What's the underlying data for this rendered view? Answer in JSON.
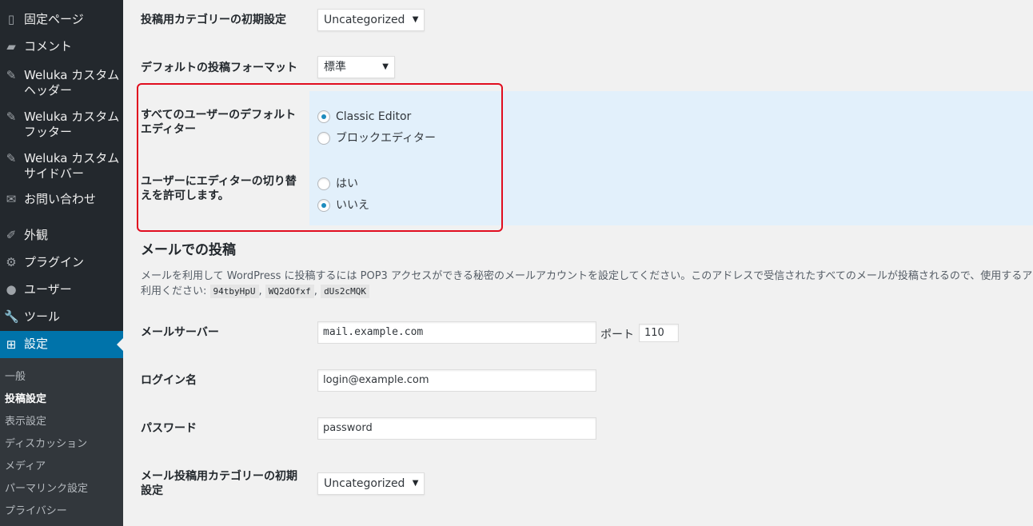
{
  "sidebar": {
    "items": [
      {
        "icon": "page-icon",
        "glyph": "▯",
        "label": "固定ページ"
      },
      {
        "icon": "comment-icon",
        "glyph": "▰",
        "label": "コメント"
      },
      {
        "icon": "pin-icon",
        "glyph": "✎",
        "label": "Weluka カスタムヘッダー"
      },
      {
        "icon": "pin-icon",
        "glyph": "✎",
        "label": "Weluka カスタムフッター"
      },
      {
        "icon": "pin-icon",
        "glyph": "✎",
        "label": "Weluka カスタムサイドバー"
      },
      {
        "icon": "mail-icon",
        "glyph": "✉",
        "label": "お問い合わせ"
      },
      {
        "icon": "appearance-icon",
        "glyph": "✐",
        "label": "外観"
      },
      {
        "icon": "plugin-icon",
        "glyph": "⚙",
        "label": "プラグイン"
      },
      {
        "icon": "user-icon",
        "glyph": "●",
        "label": "ユーザー"
      },
      {
        "icon": "tools-icon",
        "glyph": "🔧",
        "label": "ツール"
      },
      {
        "icon": "settings-icon",
        "glyph": "⊞",
        "label": "設定"
      }
    ],
    "submenu": [
      "一般",
      "投稿設定",
      "表示設定",
      "ディスカッション",
      "メディア",
      "パーマリンク設定",
      "プライバシー"
    ]
  },
  "settings": {
    "default_category_label": "投稿用カテゴリーの初期設定",
    "default_category_value": "Uncategorized",
    "default_format_label": "デフォルトの投稿フォーマット",
    "default_format_value": "標準",
    "editor_label": "すべてのユーザーのデフォルトエディター",
    "editor_options": [
      "Classic Editor",
      "ブロックエディター"
    ],
    "editor_selected": "Classic Editor",
    "allow_switch_label": "ユーザーにエディターの切り替えを許可します。",
    "allow_switch_options": [
      "はい",
      "いいえ"
    ],
    "allow_switch_selected": "いいえ"
  },
  "mail": {
    "section_title": "メールでの投稿",
    "description_line1": "メールを利用して WordPress に投稿するには POP3 アクセスができる秘密のメールアカウントを設定してください。このアドレスで受信されたすべてのメールが投稿されるので、使用するアト",
    "description_line2_prefix": "利用ください:",
    "codes": [
      "94tbyHpU",
      "WQ2dOfxf",
      "dUs2cMQK"
    ],
    "sep": ",",
    "server_label": "メールサーバー",
    "server_value": "mail.example.com",
    "port_label": "ポート",
    "port_value": "110",
    "login_label": "ログイン名",
    "login_value": "login@example.com",
    "password_label": "パスワード",
    "password_value": "password",
    "category_label": "メール投稿用カテゴリーの初期設定",
    "category_value": "Uncategorized"
  }
}
